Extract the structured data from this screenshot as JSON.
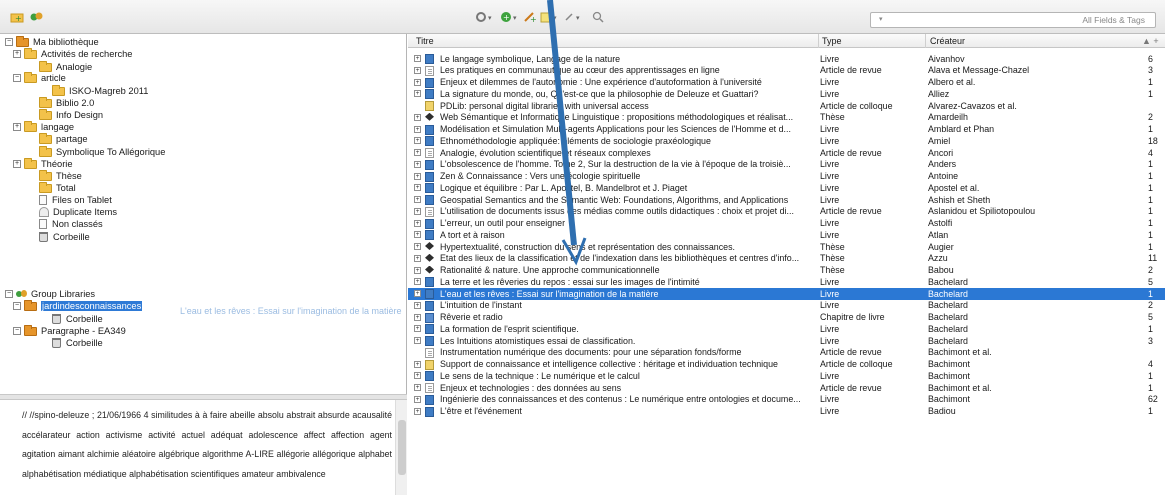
{
  "toolbar": {
    "search_placeholder": "All Fields & Tags"
  },
  "tree": {
    "items": [
      {
        "label": "Ma bibliothèque",
        "kind": "lib",
        "exp": "minus"
      },
      {
        "label": "Activités de recherche",
        "kind": "folder",
        "exp": "plus"
      },
      {
        "label": "Analogie",
        "kind": "folder",
        "exp": ""
      },
      {
        "label": "article",
        "kind": "folder",
        "exp": "minus"
      },
      {
        "label": "ISKO-Magreb 2011",
        "kind": "folder",
        "exp": ""
      },
      {
        "label": "Biblio 2.0",
        "kind": "folder",
        "exp": ""
      },
      {
        "label": "Info Design",
        "kind": "folder",
        "exp": ""
      },
      {
        "label": "langage",
        "kind": "folder",
        "exp": "plus"
      },
      {
        "label": "partage",
        "kind": "folder",
        "exp": ""
      },
      {
        "label": "Symbolique To Allégorique",
        "kind": "folder",
        "exp": ""
      },
      {
        "label": "Théorie",
        "kind": "folder",
        "exp": "plus"
      },
      {
        "label": "Thèse",
        "kind": "folder",
        "exp": ""
      },
      {
        "label": "Total",
        "kind": "folder",
        "exp": ""
      },
      {
        "label": "Files on Tablet",
        "kind": "doc",
        "exp": ""
      },
      {
        "label": "Duplicate Items",
        "kind": "dup",
        "exp": ""
      },
      {
        "label": "Non classés",
        "kind": "doc",
        "exp": ""
      },
      {
        "label": "Corbeille",
        "kind": "trash",
        "exp": ""
      },
      {
        "label": "Group Libraries",
        "kind": "group",
        "exp": "minus"
      },
      {
        "label": "jardindesconnaissances",
        "kind": "lib",
        "exp": "minus"
      },
      {
        "label": "Corbeille",
        "kind": "trash",
        "exp": ""
      },
      {
        "label": "Paragraphe - EA349",
        "kind": "lib",
        "exp": "minus"
      },
      {
        "label": "Corbeille",
        "kind": "trash",
        "exp": ""
      }
    ],
    "drag_ghost": "L'eau et les rêves : Essai sur l'imagination de la matière"
  },
  "tags": {
    "text": "//  //spino-deleuze  ;  21/06/1966  4 similitudes  à  à faire  abeille  absolu  abstrait  absurde  acausalité  accélarateur  action  activisme  activité  actuel  adéquat  adolescence  affect  affection  agent  agitation  aimant  alchimie  aléatoire  algébrique  algorithme  A-LIRE  allégorie  allégorique  alphabet  alphabétisation médiatique  alphabétisation scientifiques  amateur  ambivalence"
  },
  "items": {
    "headers": {
      "title": "Titre",
      "type": "Type",
      "creator": "Créateur"
    },
    "rows": [
      {
        "title": "Le langage symbolique, Langage de la nature",
        "type": "Livre",
        "creator": "Aivanhov",
        "count": "6",
        "icon": "book",
        "exp": true
      },
      {
        "title": "Les pratiques en communautique au cœur des apprentissages en ligne",
        "type": "Article de revue",
        "creator": "Alava et Message-Chazel",
        "count": "3",
        "icon": "article",
        "exp": true
      },
      {
        "title": "Enjeux et dilemmes de l'autonomie : Une expérience d'autoformation à l'université",
        "type": "Livre",
        "creator": "Albero et al.",
        "count": "1",
        "icon": "book",
        "exp": true
      },
      {
        "title": "La signature du monde, ou, Qu'est-ce que la philosophie de Deleuze et Guattari?",
        "type": "Livre",
        "creator": "Alliez",
        "count": "1",
        "icon": "book",
        "exp": true
      },
      {
        "title": "PDLib: personal digital libraries with universal access",
        "type": "Article de colloque",
        "creator": "Alvarez-Cavazos et al.",
        "count": "",
        "icon": "conf",
        "exp": false
      },
      {
        "title": "Web Sémantique et Informatique Linguistique : propositions méthodologiques et réalisat...",
        "type": "Thèse",
        "creator": "Amardeilh",
        "count": "2",
        "icon": "thesis",
        "exp": true
      },
      {
        "title": "Modélisation et Simulation Multi-agents Applications pour les Sciences de l'Homme et d...",
        "type": "Livre",
        "creator": "Amblard et Phan",
        "count": "1",
        "icon": "book",
        "exp": true
      },
      {
        "title": "Ethnométhodologie appliquée: éléments de sociologie praxéologique",
        "type": "Livre",
        "creator": "Amiel",
        "count": "18",
        "icon": "book",
        "exp": true
      },
      {
        "title": "Analogie, évolution scientifique et réseaux complexes",
        "type": "Article de revue",
        "creator": "Ancori",
        "count": "4",
        "icon": "article",
        "exp": true
      },
      {
        "title": "L'obsolescence de l'homme. Tome 2, Sur la destruction de la vie à l'époque de la troisiè...",
        "type": "Livre",
        "creator": "Anders",
        "count": "1",
        "icon": "book",
        "exp": true
      },
      {
        "title": "Zen & Connaissance : Vers une écologie spirituelle",
        "type": "Livre",
        "creator": "Antoine",
        "count": "1",
        "icon": "book",
        "exp": true
      },
      {
        "title": "Logique et équilibre : Par L. Apostel, B. Mandelbrot et J. Piaget",
        "type": "Livre",
        "creator": "Apostel et al.",
        "count": "1",
        "icon": "book",
        "exp": true
      },
      {
        "title": "Geospatial Semantics and the Semantic Web: Foundations, Algorithms, and Applications",
        "type": "Livre",
        "creator": "Ashish et Sheth",
        "count": "1",
        "icon": "book",
        "exp": true
      },
      {
        "title": "L'utilisation de documents issus des médias comme outils didactiques : choix et projet di...",
        "type": "Article de revue",
        "creator": "Aslanidou et Spiliotopoulou",
        "count": "1",
        "icon": "article",
        "exp": true
      },
      {
        "title": "L'erreur, un outil pour enseigner",
        "type": "Livre",
        "creator": "Astolfi",
        "count": "1",
        "icon": "book",
        "exp": true
      },
      {
        "title": "A tort et à raison",
        "type": "Livre",
        "creator": "Atlan",
        "count": "1",
        "icon": "book",
        "exp": true
      },
      {
        "title": "Hypertextualité, construction du sens et représentation des connaissances.",
        "type": "Thèse",
        "creator": "Augier",
        "count": "1",
        "icon": "thesis",
        "exp": true
      },
      {
        "title": "Etat des lieux de la classification et de l'indexation dans les bibliothèques et centres d'info...",
        "type": "Thèse",
        "creator": "Azzu",
        "count": "11",
        "icon": "thesis",
        "exp": true
      },
      {
        "title": "Rationalité & nature. Une approche communicationnelle",
        "type": "Thèse",
        "creator": "Babou",
        "count": "2",
        "icon": "thesis",
        "exp": true
      },
      {
        "title": "La terre et les rêveries du repos : essai sur les images de l'intimité",
        "type": "Livre",
        "creator": "Bachelard",
        "count": "5",
        "icon": "book",
        "exp": true
      },
      {
        "title": "L'eau et les rêves : Essai sur l'imagination de la matière",
        "type": "Livre",
        "creator": "Bachelard",
        "count": "1",
        "icon": "book",
        "exp": true,
        "selected": true
      },
      {
        "title": "L'intuition de l'instant",
        "type": "Livre",
        "creator": "Bachelard",
        "count": "2",
        "icon": "book",
        "exp": true
      },
      {
        "title": "Rêverie et radio",
        "type": "Chapitre de livre",
        "creator": "Bachelard",
        "count": "5",
        "icon": "chapter",
        "exp": true
      },
      {
        "title": "La formation de l'esprit scientifique.",
        "type": "Livre",
        "creator": "Bachelard",
        "count": "1",
        "icon": "book",
        "exp": true
      },
      {
        "title": "Les Intuitions atomistiques essai de classification.",
        "type": "Livre",
        "creator": "Bachelard",
        "count": "3",
        "icon": "book",
        "exp": true
      },
      {
        "title": "Instrumentation numérique des documents: pour une séparation fonds/forme",
        "type": "Article de revue",
        "creator": "Bachimont et al.",
        "count": "",
        "icon": "article",
        "exp": false
      },
      {
        "title": "Support de connaissance et intelligence collective : héritage et individuation technique",
        "type": "Article de colloque",
        "creator": "Bachimont",
        "count": "4",
        "icon": "conf",
        "exp": true
      },
      {
        "title": "Le sens de la technique : Le numérique et le calcul",
        "type": "Livre",
        "creator": "Bachimont",
        "count": "1",
        "icon": "book",
        "exp": true
      },
      {
        "title": "Enjeux et technologies : des données au sens",
        "type": "Article de revue",
        "creator": "Bachimont et al.",
        "count": "1",
        "icon": "article",
        "exp": true
      },
      {
        "title": "Ingénierie des connaissances et des contenus : Le numérique entre ontologies et docume...",
        "type": "Livre",
        "creator": "Bachimont",
        "count": "62",
        "icon": "book",
        "exp": true
      },
      {
        "title": "L'être et l'événement",
        "type": "Livre",
        "creator": "Badiou",
        "count": "1",
        "icon": "book",
        "exp": true
      }
    ]
  }
}
